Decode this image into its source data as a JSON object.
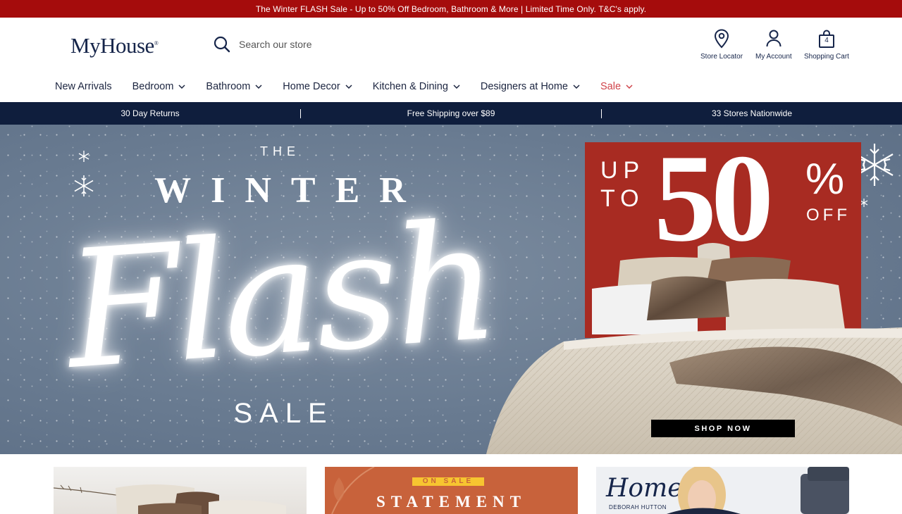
{
  "promo": {
    "text": "The Winter FLASH Sale - Up to 50% Off Bedroom, Bathroom & More | Limited Time Only. T&C's apply."
  },
  "header": {
    "logo": "MyHouse",
    "search_placeholder": "Search our store",
    "store_locator": "Store Locator",
    "my_account": "My Account",
    "shopping_cart": "Shopping Cart",
    "cart_count": "4"
  },
  "nav": {
    "new_arrivals": "New Arrivals",
    "bedroom": "Bedroom",
    "bathroom": "Bathroom",
    "home_decor": "Home Decor",
    "kitchen_dining": "Kitchen & Dining",
    "designers_at_home": "Designers at Home",
    "sale": "Sale"
  },
  "usp": {
    "returns": "30 Day Returns",
    "shipping": "Free Shipping over $89",
    "stores": "33 Stores Nationwide"
  },
  "hero": {
    "the": "THE",
    "winter": "WINTER",
    "flash": "Flash",
    "sale": "SALE",
    "up": "UP",
    "to": "TO",
    "fifty": "50",
    "percent": "%",
    "off": "OFF",
    "cta": "SHOP NOW"
  },
  "tiles": {
    "on_sale": "ON SALE",
    "statement": "STATEMENT",
    "home": "Home",
    "home_by": "DEBORAH HUTTON"
  },
  "colors": {
    "promo_red": "#a50c0c",
    "navy": "#0f1e3d",
    "sale_red": "#d0434a",
    "offer_red": "#a82b22"
  }
}
